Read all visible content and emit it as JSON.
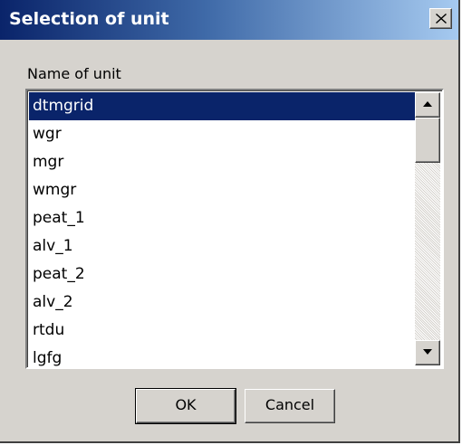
{
  "dialog": {
    "title": "Selection of unit",
    "close_label": "×"
  },
  "form": {
    "field_label": "Name of unit",
    "selected_value": "dtmgrid",
    "options": [
      {
        "label": "dtmgrid",
        "selected": true
      },
      {
        "label": "wgr",
        "selected": false
      },
      {
        "label": "mgr",
        "selected": false
      },
      {
        "label": "wmgr",
        "selected": false
      },
      {
        "label": "peat_1",
        "selected": false
      },
      {
        "label": "alv_1",
        "selected": false
      },
      {
        "label": "peat_2",
        "selected": false
      },
      {
        "label": "alv_2",
        "selected": false
      },
      {
        "label": "rtdu",
        "selected": false
      },
      {
        "label": "lgfg",
        "selected": false
      }
    ]
  },
  "buttons": {
    "ok_label": "OK",
    "cancel_label": "Cancel"
  },
  "icons": {
    "close": "close-icon",
    "scroll_up": "arrow-up-icon",
    "scroll_down": "arrow-down-icon"
  },
  "colors": {
    "title_start": "#0a246a",
    "title_end": "#a6caf0",
    "selection": "#0a246a",
    "dialog_face": "#d6d3ce"
  }
}
